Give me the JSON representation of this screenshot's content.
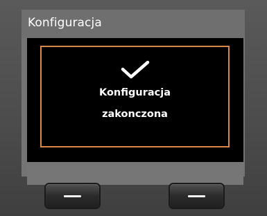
{
  "screen": {
    "title": "Konfiguracja"
  },
  "dialog": {
    "icon": "checkmark-icon",
    "message_line1": "Konfiguracja",
    "message_line2": "zakonczona"
  },
  "softkeys": {
    "left_icon": "dash-icon",
    "right_icon": "dash-icon"
  },
  "colors": {
    "dialog_border": "#d9884a",
    "display_background": "#000000",
    "text": "#ffffff"
  }
}
